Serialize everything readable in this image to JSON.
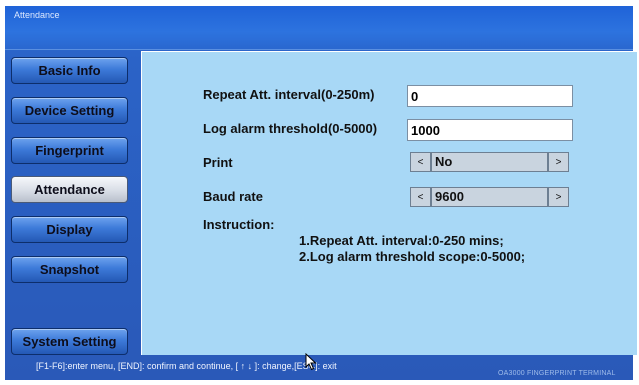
{
  "window": {
    "title": "Attendance",
    "brand": "OA3000 FINGERPRINT TERMINAL"
  },
  "sidebar": {
    "items": [
      {
        "label": "Basic Info",
        "active": false
      },
      {
        "label": "Device Setting",
        "active": false
      },
      {
        "label": "Fingerprint",
        "active": false
      },
      {
        "label": "Attendance",
        "active": true
      },
      {
        "label": "Display",
        "active": false
      },
      {
        "label": "Snapshot",
        "active": false
      },
      {
        "label": "System Setting",
        "active": false
      }
    ]
  },
  "form": {
    "repeat_interval": {
      "label": "Repeat Att. interval(0-250m)",
      "value": "0"
    },
    "log_alarm": {
      "label": "Log alarm threshold(0-5000)",
      "value": "1000"
    },
    "print": {
      "label": "Print",
      "value": "No",
      "prev": "<",
      "next": ">"
    },
    "baud_rate": {
      "label": "Baud rate",
      "value": "9600",
      "prev": "<",
      "next": ">"
    },
    "instruction": {
      "label": "Instruction:",
      "lines": [
        "1.Repeat Att. interval:0-250 mins;",
        "2.Log alarm threshold scope:0-5000;"
      ]
    }
  },
  "status": {
    "hint": "[F1-F6]:enter menu, [END]: confirm and continue, [ ↑ ↓ ]: change,[ESC]: exit"
  },
  "colors": {
    "frame_blue": "#2a63c7",
    "panel_bg": "#a8d8f6",
    "active_button": "#d8dde6"
  }
}
